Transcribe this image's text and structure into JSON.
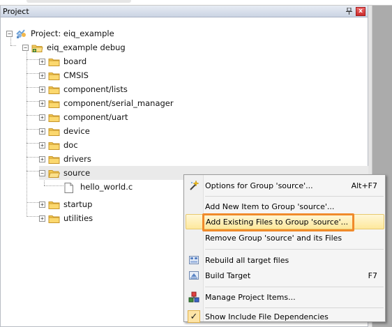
{
  "panel": {
    "title": "Project",
    "pin_glyph": "⌵",
    "close_glyph": "x"
  },
  "tree": {
    "root": "Project: eiq_example",
    "target": "eiq_example debug",
    "groups": [
      "board",
      "CMSIS",
      "component/lists",
      "component/serial_manager",
      "component/uart",
      "device",
      "doc",
      "drivers",
      "source"
    ],
    "source_file": "hello_world.c",
    "after_groups": [
      "startup",
      "utilities"
    ]
  },
  "context_menu": {
    "items": [
      {
        "label": "Options for Group 'source'...",
        "shortcut": "Alt+F7",
        "icon": "wand-icon"
      },
      {
        "label": "Add New  Item to Group 'source'...",
        "shortcut": "",
        "icon": ""
      },
      {
        "label": "Add Existing Files to Group 'source'...",
        "shortcut": "",
        "icon": "",
        "hover": true
      },
      {
        "label": "Remove Group 'source' and its Files",
        "shortcut": "",
        "icon": ""
      },
      {
        "label": "Rebuild all target files",
        "shortcut": "",
        "icon": "rebuild-icon"
      },
      {
        "label": "Build Target",
        "shortcut": "F7",
        "icon": "build-icon"
      },
      {
        "label": "Manage Project Items...",
        "shortcut": "",
        "icon": "manage-icon"
      },
      {
        "label": "Show Include File Dependencies",
        "shortcut": "",
        "icon": "check-icon",
        "checked": true
      }
    ]
  },
  "colors": {
    "highlight_border": "#f08a2a",
    "hover_bg": "#fde89c"
  }
}
